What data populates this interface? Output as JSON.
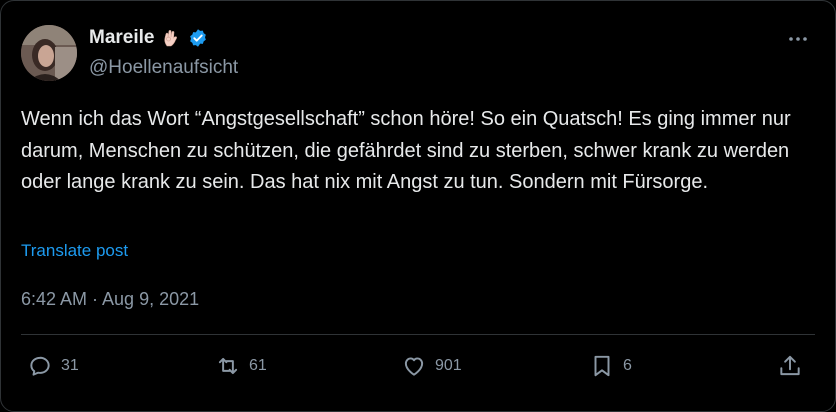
{
  "author": {
    "display_name": "Mareile",
    "handle": "@Hoellenaufsicht",
    "name_emoji": "ok-hand-emoji",
    "verified_badge": "verified-icon",
    "verified_color": "#1d9bf0"
  },
  "post": {
    "text": "Wenn ich das Wort “Angstgesellschaft” schon höre! So ein Quatsch! Es ging immer nur darum, Menschen zu schützen, die gefährdet sind zu sterben, schwer krank zu werden oder lange krank zu sein. Das hat nix mit Angst zu tun. Sondern mit Fürsorge.",
    "translate_label": "Translate post",
    "timestamp": "6:42 AM · Aug 9, 2021"
  },
  "actions": {
    "replies": "31",
    "reposts": "61",
    "likes": "901",
    "bookmarks": "6"
  },
  "icons": {
    "more": "more-icon",
    "reply": "reply-icon",
    "repost": "repost-icon",
    "like": "heart-icon",
    "bookmark": "bookmark-icon",
    "share": "share-icon"
  },
  "colors": {
    "background": "#000000",
    "text": "#e7e9ea",
    "secondary": "#8b98a5",
    "link": "#1d9bf0",
    "border": "#2f3336"
  }
}
